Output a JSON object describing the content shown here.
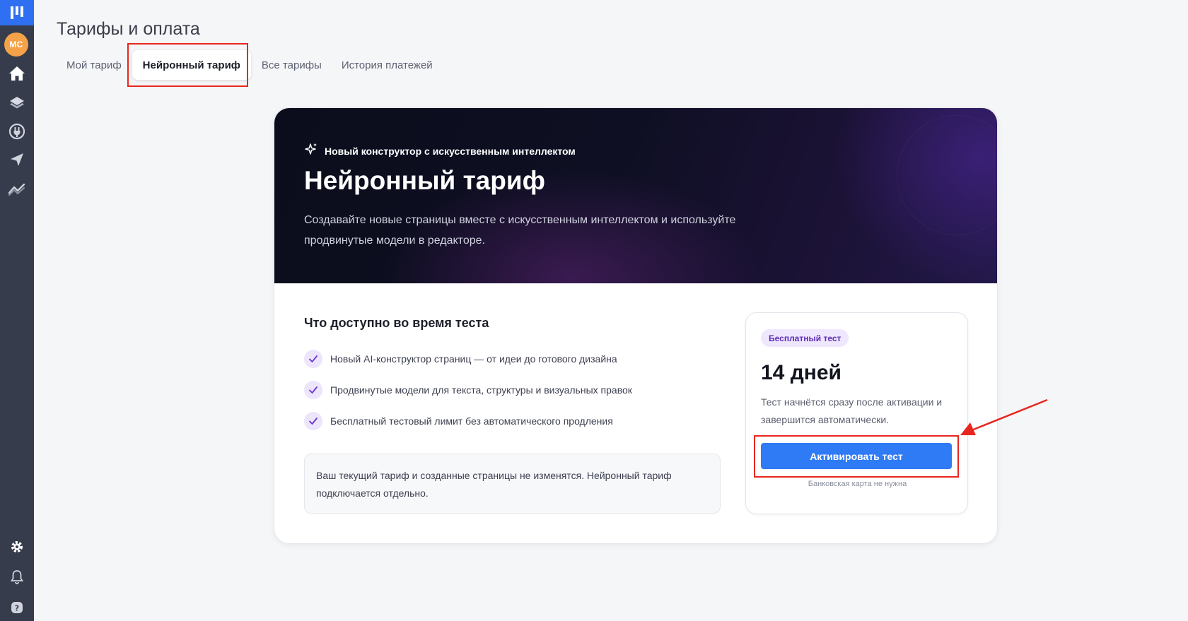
{
  "sidebar": {
    "avatar_initials": "MC",
    "icons": [
      "logo-icon",
      "home-icon",
      "layers-icon",
      "plug-icon",
      "send-icon",
      "analytics-icon",
      "gear-icon",
      "bell-icon",
      "help-icon"
    ]
  },
  "header": {
    "title": "Тарифы и оплата",
    "tabs": [
      {
        "label": "Мой тариф",
        "active": false
      },
      {
        "label": "Нейронный тариф",
        "active": true
      },
      {
        "label": "Все тарифы",
        "active": false
      },
      {
        "label": "История платежей",
        "active": false
      }
    ]
  },
  "hero": {
    "badge": "Новый конструктор с искусственным интеллектом",
    "title": "Нейронный тариф",
    "description": "Создавайте новые страницы вместе с искусственным интеллектом и используйте продвинутые модели в редакторе."
  },
  "features": {
    "title": "Что доступно во время теста",
    "items": [
      "Новый AI-конструктор страниц — от идеи до готового дизайна",
      "Продвинутые модели для текста, структуры и визуальных правок",
      "Бесплатный тестовый лимит без автоматического продления"
    ],
    "note": "Ваш текущий тариф и созданные страницы не изменятся. Нейронный тариф подключается отдельно."
  },
  "trial": {
    "pill": "Бесплатный тест",
    "days": "14 дней",
    "description": "Тест начнётся сразу после активации и завершится автоматически.",
    "button": "Активировать тест",
    "footnote": "Банковская карта не нужна"
  },
  "colors": {
    "accent": "#2f7bf5",
    "sidebar": "#363c4b",
    "highlight": "#e8261f",
    "avatar": "#f5a248",
    "pill_bg": "#efe7fd",
    "pill_text": "#5b2bb8"
  }
}
